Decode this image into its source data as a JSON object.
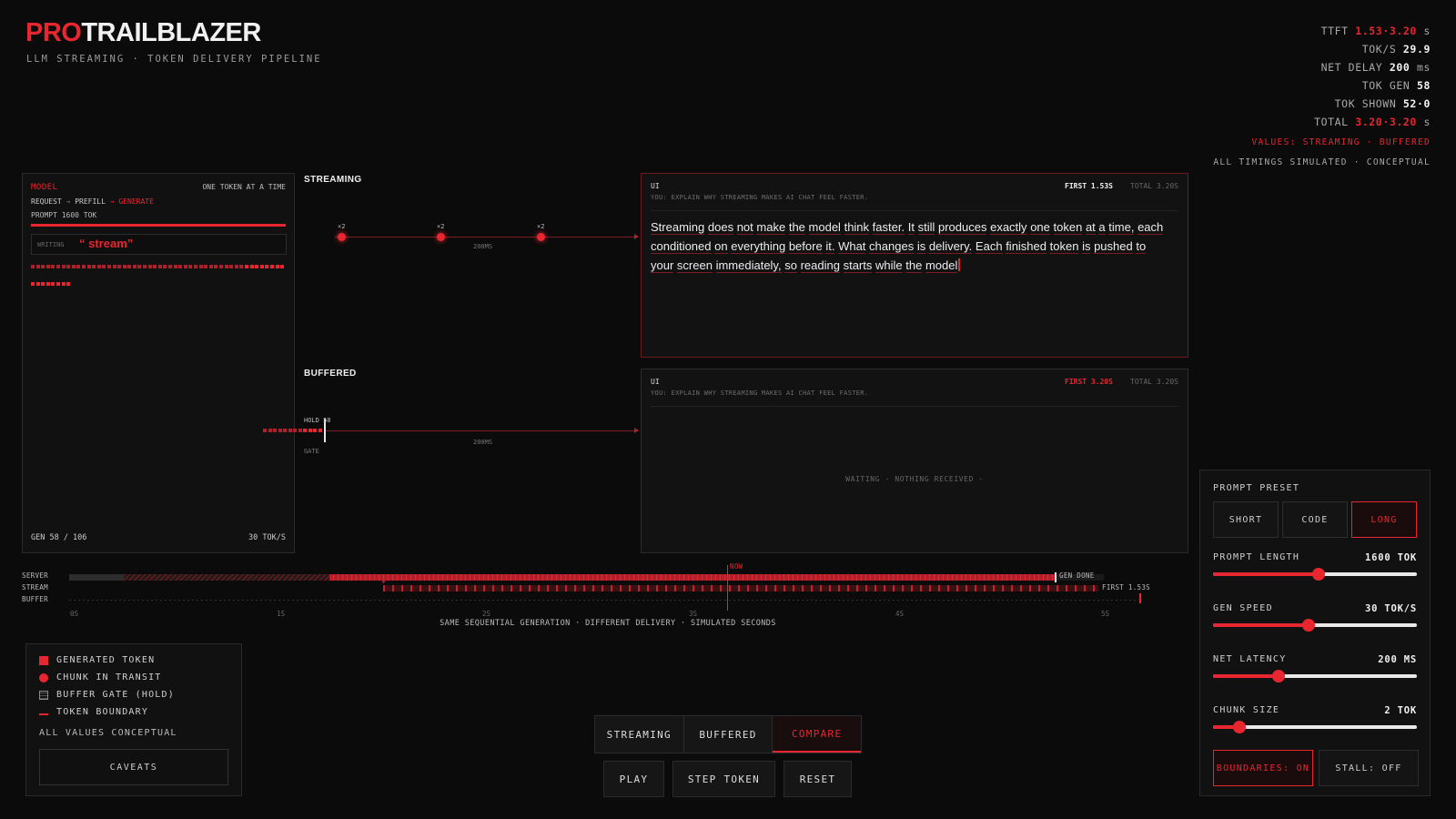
{
  "brand": {
    "pro": "PRO",
    "rest": "TRAILBLAZER",
    "subtitle": "LLM STREAMING · TOKEN DELIVERY PIPELINE"
  },
  "stats": {
    "ttft_label": "TTFT",
    "ttft_value": "1.53·3.20",
    "ttft_unit": "s",
    "toks_label": "TOK/S",
    "toks_value": "29.9",
    "net_label": "NET DELAY",
    "net_value": "200",
    "net_unit": "ms",
    "gen_label": "TOK GEN",
    "gen_value": "58",
    "shown_label": "TOK SHOWN",
    "shown_value": "52·0",
    "total_label": "TOTAL",
    "total_value": "3.20·3.20",
    "total_unit": "s",
    "values_note": "VALUES: STREAMING · BUFFERED",
    "timings_note": "ALL TIMINGS SIMULATED · CONCEPTUAL"
  },
  "model": {
    "title": "MODEL",
    "mode": "ONE TOKEN AT A TIME",
    "step1": "REQUEST",
    "step2": "PREFILL",
    "step3": "GENERATE",
    "arrow": "→",
    "prompt": "PROMPT 1600 TOK",
    "writing_label": "WRITING",
    "writing_token": "“ stream”",
    "generated": 58,
    "highlighted_from": 42,
    "gen_status": "GEN 58 / 106",
    "speed": "30 TOK/S"
  },
  "streaming": {
    "title": "STREAMING",
    "chunk_label": "×2",
    "latency_label": "200MS",
    "ui": {
      "label": "UI",
      "prompt": "YOU: EXPLAIN WHY STREAMING MAKES AI CHAT FEEL FASTER.",
      "first": "FIRST 1.53S",
      "total": "TOTAL 3.20S",
      "text_words": [
        "Streaming",
        "does",
        "not",
        "make",
        "the",
        "model",
        "think",
        "faster.",
        "It",
        "still",
        "produces",
        "exactly",
        "one",
        "token",
        "at",
        "a",
        "time,",
        "each",
        "conditioned",
        "on",
        "everything",
        "before",
        "it.",
        "What",
        "changes",
        "is",
        "delivery.",
        "Each",
        "finished",
        "token",
        "is",
        "pushed",
        "to",
        "your",
        "screen",
        "immediately,",
        "so",
        "reading",
        "starts",
        "while",
        "the",
        "model"
      ]
    }
  },
  "buffered": {
    "title": "BUFFERED",
    "hold_label": "HOLD 58",
    "gate_label": "GATE",
    "latency_label": "200MS",
    "ui": {
      "label": "UI",
      "prompt": "YOU: EXPLAIN WHY STREAMING MAKES AI CHAT FEEL FASTER.",
      "first": "FIRST 3.20S",
      "total": "TOTAL 3.20S",
      "waiting": "WAITING · NOTHING RECEIVED ·"
    }
  },
  "timeline": {
    "lanes": [
      "SERVER",
      "STREAM",
      "BUFFER"
    ],
    "ticks": [
      "0S",
      "1S",
      "2S",
      "3S",
      "4S",
      "5S"
    ],
    "now_label": "NOW",
    "gen_done": "GEN DONE",
    "first_label": "FIRST 1.53S",
    "caption": "SAME SEQUENTIAL GENERATION · DIFFERENT DELIVERY · SIMULATED SECONDS"
  },
  "legend": {
    "items": [
      "GENERATED TOKEN",
      "CHUNK IN TRANSIT",
      "BUFFER GATE (HOLD)",
      "TOKEN BOUNDARY"
    ],
    "note": "ALL VALUES CONCEPTUAL",
    "caveats": "CAVEATS"
  },
  "modes": {
    "streaming": "STREAMING",
    "buffered": "BUFFERED",
    "compare": "COMPARE",
    "active": "compare"
  },
  "actions": {
    "play": "PLAY",
    "step": "STEP TOKEN",
    "reset": "RESET"
  },
  "controls": {
    "preset_title": "PROMPT PRESET",
    "presets": [
      "SHORT",
      "CODE",
      "LONG"
    ],
    "preset_active": "LONG",
    "prompt_length": {
      "label": "PROMPT LENGTH",
      "value": "1600 TOK",
      "fraction": 0.52
    },
    "gen_speed": {
      "label": "GEN SPEED",
      "value": "30 TOK/S",
      "fraction": 0.47
    },
    "net_latency": {
      "label": "NET LATENCY",
      "value": "200 MS",
      "fraction": 0.32
    },
    "chunk_size": {
      "label": "CHUNK SIZE",
      "value": "2 TOK",
      "fraction": 0.13
    },
    "boundaries": "BOUNDARIES: ON",
    "stall": "STALL: OFF"
  },
  "colors": {
    "accent": "#e8262f",
    "background": "#0b0b0b",
    "panel": "#111111"
  }
}
